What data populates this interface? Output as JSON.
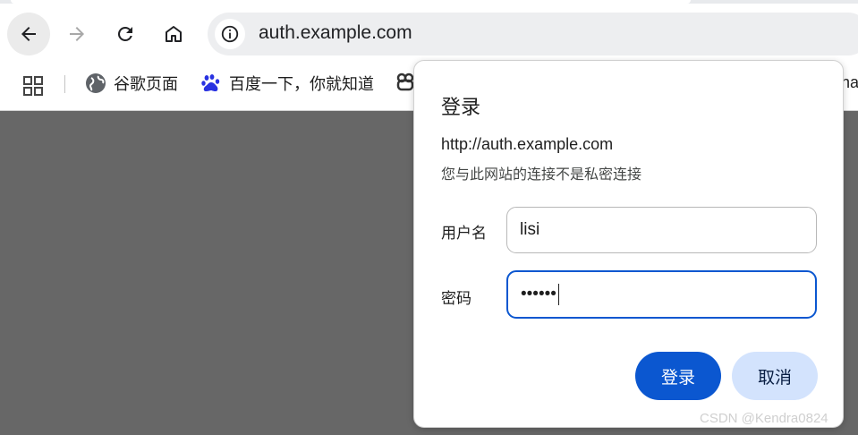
{
  "browser": {
    "url": "auth.example.com",
    "nav": {
      "back": "arrow-left-icon",
      "forward": "arrow-right-icon",
      "reload": "reload-icon",
      "home": "home-icon"
    },
    "site_info_icon": "info-icon"
  },
  "bookmarks": {
    "apps_icon": "apps-grid-icon",
    "items": [
      {
        "label": "谷歌页面",
        "icon": "globe-icon"
      },
      {
        "label": "百度一下，你就知道",
        "icon": "baidu-paw-icon"
      },
      {
        "label": "",
        "icon": "folder-icon"
      }
    ],
    "overflow_text": "na"
  },
  "dialog": {
    "title": "登录",
    "url": "http://auth.example.com",
    "warning": "您与此网站的连接不是私密连接",
    "username_label": "用户名",
    "username_value": "lisi",
    "password_label": "密码",
    "password_value": "••••••",
    "login_button": "登录",
    "cancel_button": "取消"
  },
  "watermark": "CSDN @Kendra0824",
  "colors": {
    "accent": "#0b57d0",
    "secondary_button": "#d3e3fd",
    "page_overlay": "#676767"
  }
}
